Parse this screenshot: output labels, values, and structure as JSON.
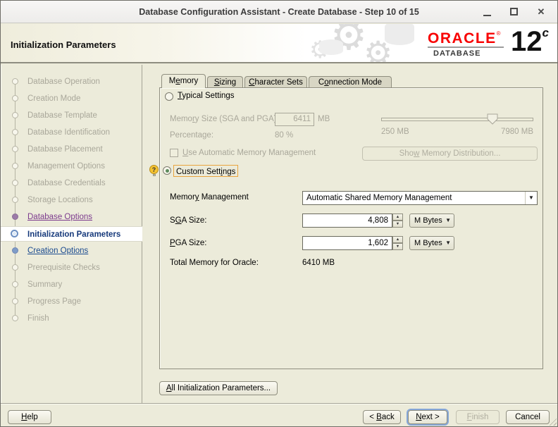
{
  "window": {
    "title": "Database Configuration Assistant - Create Database - Step 10 of 15"
  },
  "icons": {
    "gear": "⚙",
    "close": "✕",
    "hint_question": "?",
    "combo_arrow": "▼",
    "spin_up": "▲",
    "spin_down": "▼"
  },
  "header": {
    "title": "Initialization Parameters",
    "logo": {
      "brand": "ORACLE",
      "reg": "®",
      "sub": "DATABASE",
      "version": "12",
      "version_sup": "c"
    }
  },
  "sidebar": {
    "items": [
      {
        "label": "Database Operation",
        "state": "pending"
      },
      {
        "label": "Creation Mode",
        "state": "pending"
      },
      {
        "label": "Database Template",
        "state": "pending"
      },
      {
        "label": "Database Identification",
        "state": "pending"
      },
      {
        "label": "Database Placement",
        "state": "pending"
      },
      {
        "label": "Management Options",
        "state": "pending"
      },
      {
        "label": "Database Credentials",
        "state": "pending"
      },
      {
        "label": "Storage Locations",
        "state": "pending"
      },
      {
        "label": "Database Options",
        "state": "visited"
      },
      {
        "label": "Initialization Parameters",
        "state": "current"
      },
      {
        "label": "Creation Options",
        "state": "next"
      },
      {
        "label": "Prerequisite Checks",
        "state": "pending"
      },
      {
        "label": "Summary",
        "state": "pending"
      },
      {
        "label": "Progress Page",
        "state": "pending"
      },
      {
        "label": "Finish",
        "state": "pending"
      }
    ]
  },
  "tabs": [
    {
      "label": {
        "text": "Memory",
        "u": 1
      },
      "active": true
    },
    {
      "label": {
        "text": "Sizing",
        "u": 0
      },
      "active": false
    },
    {
      "label": {
        "text": "Character Sets",
        "u": 0
      },
      "active": false
    },
    {
      "label": {
        "text": "Connection Mode",
        "u": 1
      },
      "active": false
    }
  ],
  "memory_tab": {
    "typical_radio": {
      "label": {
        "text": "Typical Settings",
        "u": 0
      },
      "selected": false
    },
    "memory_size_label": {
      "text": "Memory Size (SGA and PGA):",
      "u": 4
    },
    "memory_size_value": "6411",
    "memory_size_unit": "MB",
    "percentage_label": {
      "text": "Percentage:"
    },
    "percentage_value": "80 %",
    "slider": {
      "min_label": "250 MB",
      "max_label": "7980 MB",
      "value_mb": 6411
    },
    "amm_checkbox": {
      "label": {
        "text": "Use Automatic Memory Management",
        "u": 0
      },
      "checked": false
    },
    "show_memory_distribution_button": {
      "text": "Show Memory Distribution...",
      "u": 3
    },
    "custom_radio": {
      "label": {
        "text": "Custom Settings",
        "u": 11
      },
      "selected": true
    },
    "memory_management_label": {
      "text": "Memory Management",
      "u": 5
    },
    "memory_management_value": "Automatic Shared Memory Management",
    "sga": {
      "label": {
        "text": "SGA Size:",
        "u": 1
      },
      "value": "4,808",
      "unit": "M Bytes"
    },
    "pga": {
      "label": {
        "text": "PGA Size:",
        "u": 0
      },
      "value": "1,602",
      "unit": "M Bytes"
    },
    "total_label": {
      "text": "Total Memory for Oracle:"
    },
    "total_value": "6410 MB"
  },
  "buttons": {
    "all_init_params": {
      "text": "All Initialization Parameters...",
      "u": 0
    },
    "help": {
      "text": "Help",
      "u": 0
    },
    "back": {
      "text": "< Back",
      "u": 2
    },
    "next": {
      "text": "Next >",
      "u": 0
    },
    "finish": {
      "text": "Finish",
      "u": 0
    },
    "cancel": {
      "text": "Cancel"
    }
  }
}
